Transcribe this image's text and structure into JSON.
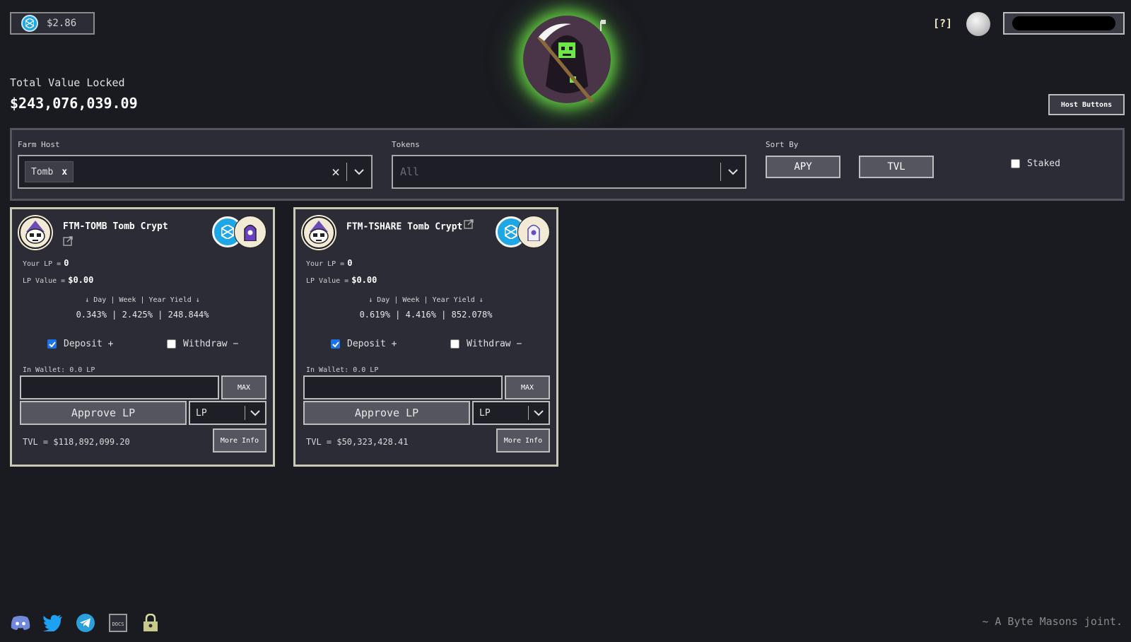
{
  "header": {
    "ftm_price": "$2.86",
    "help_label": "[?]",
    "total_value_locked_label": "Total Value Locked",
    "total_value_locked": "$243,076,039.09",
    "host_buttons_label": "Host Buttons"
  },
  "filters": {
    "farm_host_label": "Farm Host",
    "farm_host_selected": "Tomb",
    "farm_host_chip_remove": "x",
    "clear_icon": "×",
    "tokens_label": "Tokens",
    "tokens_placeholder": "All",
    "sort_by_label": "Sort By",
    "sort_apy": "APY",
    "sort_tvl": "TVL",
    "staked_label": "Staked",
    "staked_checked": false
  },
  "cards": [
    {
      "title": "FTM-TOMB Tomb Crypt",
      "your_lp_label": "Your LP =",
      "your_lp": "0",
      "lp_value_label": "LP Value =",
      "lp_value": "$0.00",
      "yield_header": "↓ Day | Week | Year Yield ↓",
      "yield_values": "0.343% | 2.425% | 248.844%",
      "deposit_label": "Deposit +",
      "deposit_checked": true,
      "withdraw_label": "Withdraw −",
      "withdraw_checked": false,
      "in_wallet": "In Wallet: 0.0 LP",
      "max_label": "MAX",
      "approve_label": "Approve LP",
      "lp_select": "LP",
      "tvl": "TVL = $118,892,099.20",
      "more_info_label": "More Info",
      "token_b_icon": "tomb-gravestone-icon"
    },
    {
      "title": "FTM-TSHARE Tomb Crypt",
      "your_lp_label": "Your LP =",
      "your_lp": "0",
      "lp_value_label": "LP Value =",
      "lp_value": "$0.00",
      "yield_header": "↓ Day | Week | Year Yield ↓",
      "yield_values": "0.619% | 4.416% | 852.078%",
      "deposit_label": "Deposit +",
      "deposit_checked": true,
      "withdraw_label": "Withdraw −",
      "withdraw_checked": false,
      "in_wallet": "In Wallet: 0.0 LP",
      "max_label": "MAX",
      "approve_label": "Approve LP",
      "lp_select": "LP",
      "tvl": "TVL = $50,323,428.41",
      "more_info_label": "More Info",
      "token_b_icon": "tshare-gravestone-icon"
    }
  ],
  "footer": {
    "icons": [
      "discord-icon",
      "twitter-icon",
      "telegram-icon",
      "docs-icon",
      "lock-icon"
    ],
    "docs_text": "DOCS",
    "tagline": "~ A Byte Masons joint."
  },
  "colors": {
    "background": "#1a1a21",
    "panel": "#2c2c36",
    "card_border": "#c9c9b6",
    "ftm_blue": "#1ea7e4",
    "logo_glow": "#6ee646"
  }
}
